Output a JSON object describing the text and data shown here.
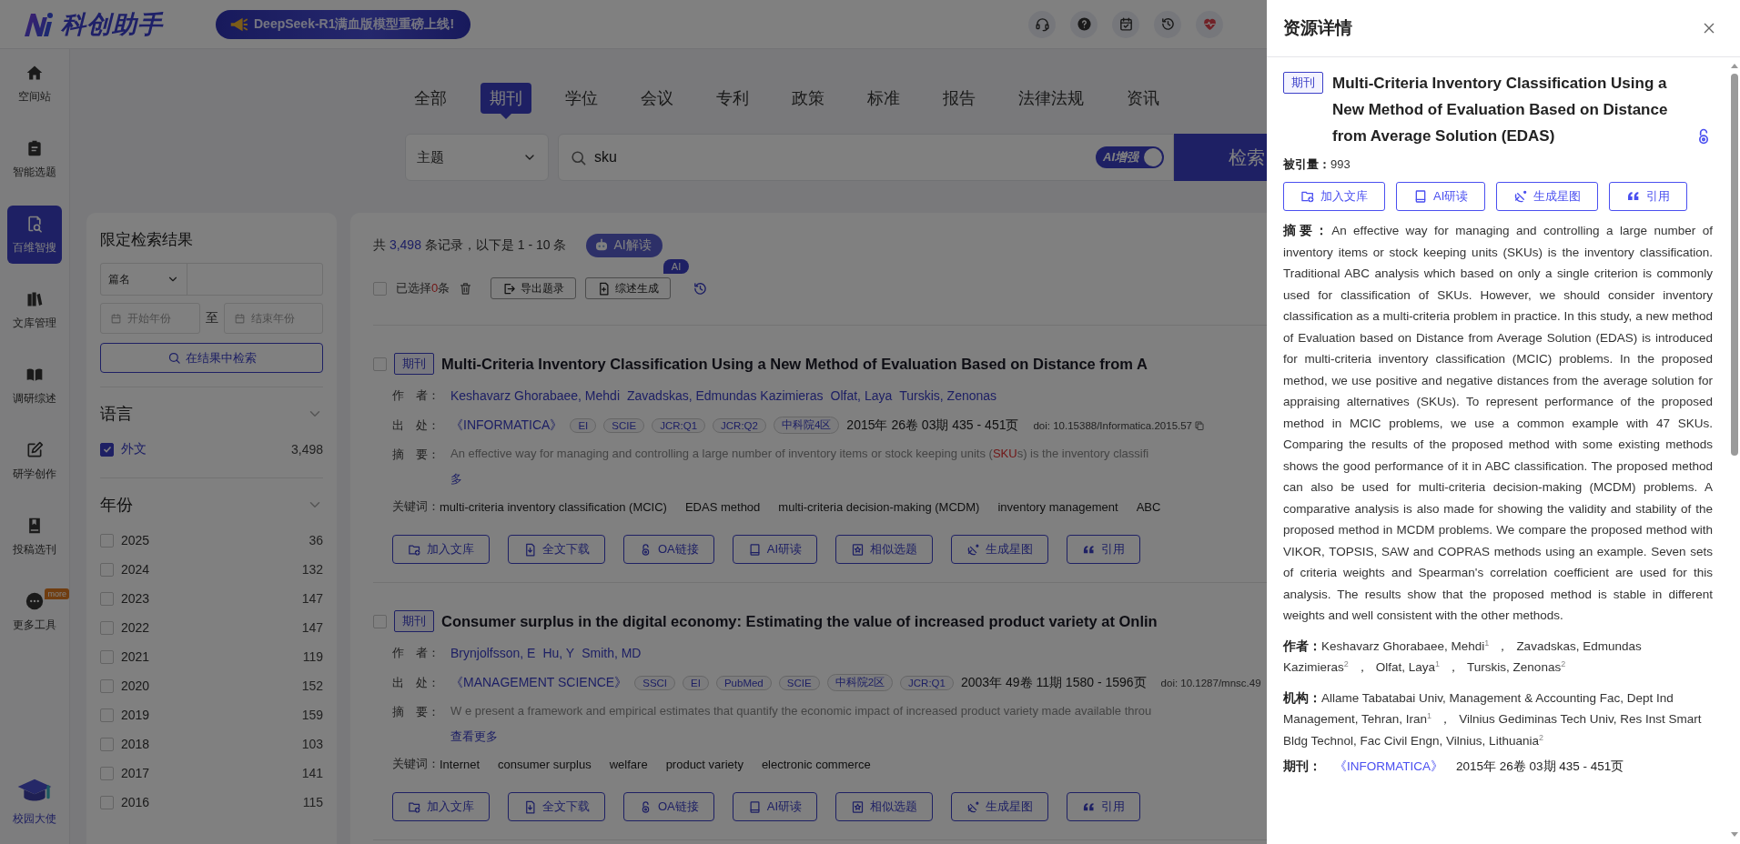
{
  "header": {
    "brand": "科创助手",
    "banner": "DeepSeek-R1满血版模型重磅上线!"
  },
  "sidebar": {
    "items": [
      {
        "label": "空间站",
        "selected": false
      },
      {
        "label": "智能选题",
        "selected": false
      },
      {
        "label": "百维智搜",
        "selected": true
      },
      {
        "label": "文库管理",
        "selected": false
      },
      {
        "label": "调研综述",
        "selected": false
      },
      {
        "label": "研学创作",
        "selected": false
      },
      {
        "label": "投稿选刊",
        "selected": false
      },
      {
        "label": "更多工具",
        "selected": false,
        "badge": "more"
      }
    ],
    "footer": {
      "label": "校园大使"
    }
  },
  "category_tabs": [
    {
      "label": "全部",
      "selected": false
    },
    {
      "label": "期刊",
      "selected": true
    },
    {
      "label": "学位",
      "selected": false
    },
    {
      "label": "会议",
      "selected": false
    },
    {
      "label": "专利",
      "selected": false
    },
    {
      "label": "政策",
      "selected": false
    },
    {
      "label": "标准",
      "selected": false
    },
    {
      "label": "报告",
      "selected": false
    },
    {
      "label": "法律法规",
      "selected": false
    },
    {
      "label": "资讯",
      "selected": false
    }
  ],
  "search": {
    "field_select": "主题",
    "query": "sku",
    "ai_toggle": {
      "label": "AI增强",
      "on": true
    },
    "button": "检索"
  },
  "filter_panel": {
    "title": "限定检索结果",
    "field_select": "篇名",
    "start_placeholder": "开始年份",
    "separator": "至",
    "end_placeholder": "结束年份",
    "button": "在结果中检索",
    "sections": [
      {
        "title": "语言",
        "expanded": true,
        "items": [
          {
            "label": "外文",
            "count": "3,498",
            "checked": true
          }
        ]
      },
      {
        "title": "年份",
        "expanded": true,
        "items": [
          {
            "label": "2025",
            "count": "36",
            "checked": false
          },
          {
            "label": "2024",
            "count": "132",
            "checked": false
          },
          {
            "label": "2023",
            "count": "147",
            "checked": false
          },
          {
            "label": "2022",
            "count": "147",
            "checked": false
          },
          {
            "label": "2021",
            "count": "119",
            "checked": false
          },
          {
            "label": "2020",
            "count": "152",
            "checked": false
          },
          {
            "label": "2019",
            "count": "159",
            "checked": false
          },
          {
            "label": "2018",
            "count": "103",
            "checked": false
          },
          {
            "label": "2017",
            "count": "141",
            "checked": false
          },
          {
            "label": "2016",
            "count": "115",
            "checked": false
          }
        ]
      }
    ]
  },
  "results": {
    "summary": {
      "prefix": "共 ",
      "total": "3,498",
      "suffix": " 条记录，以下是 1 - 10 条"
    },
    "ai_button": "AI解读",
    "selection": {
      "checked": false,
      "prefix": "已选择",
      "count": "0",
      "suffix": "条"
    },
    "toolbar": [
      {
        "label": "导出题录"
      },
      {
        "label": "综述生成",
        "badge": "AI"
      }
    ],
    "items": [
      {
        "checked": false,
        "tag": "期刊",
        "title": "Multi-Criteria Inventory Classification Using a New Method of Evaluation Based on Distance from A",
        "authors_label": "作　者：",
        "authors": [
          "Keshavarz Ghorabaee, Mehdi",
          "Zavadskas, Edmundas Kazimieras",
          "Olfat, Laya",
          "Turskis, Zenonas"
        ],
        "source_label": "出　处：",
        "journal": "《INFORMATICA》",
        "badges": [
          "EI",
          "SCIE",
          "JCR:Q1",
          "JCR:Q2",
          "中科院4区"
        ],
        "issue": "2015年 26卷 03期 435 - 451页",
        "doi": "doi: 10.15388/Informatica.2015.57",
        "copy_icon": true,
        "abstract_label": "摘　要：",
        "abstract": [
          {
            "text": "An effective way for managing and controlling a large number of inventory items or stock keeping units (",
            "highlight": false
          },
          {
            "text": "SKU",
            "highlight": true
          },
          {
            "text": "s) is the inventory classifi",
            "highlight": false
          }
        ],
        "more_link": "多",
        "keywords_label": "关键词：",
        "keywords": [
          "multi-criteria inventory classification (MCIC)",
          "EDAS method",
          "multi-criteria decision-making (MCDM)",
          "inventory management",
          "ABC"
        ],
        "actions": [
          {
            "label": "加入文库"
          },
          {
            "label": "全文下载"
          },
          {
            "label": "OA链接"
          },
          {
            "label": "AI研读"
          },
          {
            "label": "相似选题"
          },
          {
            "label": "生成星图"
          },
          {
            "label": "引用"
          }
        ]
      },
      {
        "checked": false,
        "tag": "期刊",
        "title": "Consumer surplus in the digital economy: Estimating the value of increased product variety at Onlin",
        "authors_label": "作　者：",
        "authors": [
          "Brynjolfsson, E",
          "Hu, Y",
          "Smith, MD"
        ],
        "source_label": "出　处：",
        "journal": "《MANAGEMENT SCIENCE》",
        "badges": [
          "SSCI",
          "EI",
          "PubMed",
          "SCIE",
          "中科院2区",
          "JCR:Q1"
        ],
        "issue": "2003年 49卷 11期 1580 - 1596页",
        "doi": "doi: 10.1287/mnsc.49",
        "copy_icon": false,
        "abstract_label": "摘　要：",
        "abstract": [
          {
            "text": "W e present a framework and empirical estimates that quantify the economic impact of increased product variety made available throu",
            "highlight": false
          }
        ],
        "more_link": "查看更多",
        "keywords_label": "关键词：",
        "keywords": [
          "Internet",
          "consumer surplus",
          "welfare",
          "product variety",
          "electronic commerce"
        ],
        "actions": [
          {
            "label": "加入文库"
          },
          {
            "label": "全文下载"
          },
          {
            "label": "OA链接"
          },
          {
            "label": "AI研读"
          },
          {
            "label": "相似选题"
          },
          {
            "label": "生成星图"
          },
          {
            "label": "引用"
          }
        ]
      }
    ]
  },
  "drawer": {
    "title": "资源详情",
    "tag": "期刊",
    "article_title": "Multi-Criteria Inventory Classification Using a New Method of Evaluation Based on Distance from Average Solution (EDAS)",
    "open_access": true,
    "citations": {
      "label": "被引量：",
      "value": "993"
    },
    "actions": [
      {
        "label": "加入文库"
      },
      {
        "label": "AI研读"
      },
      {
        "label": "生成星图"
      },
      {
        "label": "引用"
      }
    ],
    "abstract": {
      "label": "摘要：",
      "text": "An effective way for managing and controlling a large number of inventory items or stock keeping units (SKUs) is the inventory classification. Traditional ABC analysis which based on only a single criterion is commonly used for classification of SKUs. However, we should consider inventory classification as a multi-criteria problem in practice. In this study, a new method of Evaluation based on Distance from Average Solution (EDAS) is introduced for multi-criteria inventory classification (MCIC) problems. In the proposed method, we use positive and negative distances from the average solution for appraising alternatives (SKUs). To represent performance of the proposed method in MCIC problems, we use a common example with 47 SKUs. Comparing the results of the proposed method with some existing methods shows the good performance of it in ABC classification. The proposed method can also be used for multi-criteria decision-making (MCDM) problems. A comparative analysis is also made for showing the validity and stability of the proposed method in MCDM problems. We compare the proposed method with VIKOR, TOPSIS, SAW and COPRAS methods using an example. Seven sets of criteria weights and Spearman's correlation coefficient are used for this analysis. The results show that the proposed method is stable in different weights and well consistent with the other methods."
    },
    "authors": {
      "label": "作者：",
      "separator": "，",
      "items": [
        {
          "name": "Keshavarz Ghorabaee, Mehdi",
          "sup": "1"
        },
        {
          "name": "Zavadskas, Edmundas Kazimieras",
          "sup": "2"
        },
        {
          "name": "Olfat, Laya",
          "sup": "1"
        },
        {
          "name": "Turskis, Zenonas",
          "sup": "2"
        }
      ]
    },
    "affiliations": {
      "label": "机构：",
      "separator": "，",
      "items": [
        {
          "name": "Allame Tabatabai Univ, Management & Accounting Fac, Dept Ind Management, Tehran, Iran",
          "sup": "1"
        },
        {
          "name": "Vilnius Gediminas Tech Univ, Res Inst Smart Bldg Technol, Fac Civil Engn, Vilnius, Lithuania",
          "sup": "2"
        }
      ]
    },
    "journal": {
      "label": "期刊：",
      "name": "《INFORMATICA》",
      "issue": "2015年 26卷 03期 435 - 451页"
    }
  }
}
